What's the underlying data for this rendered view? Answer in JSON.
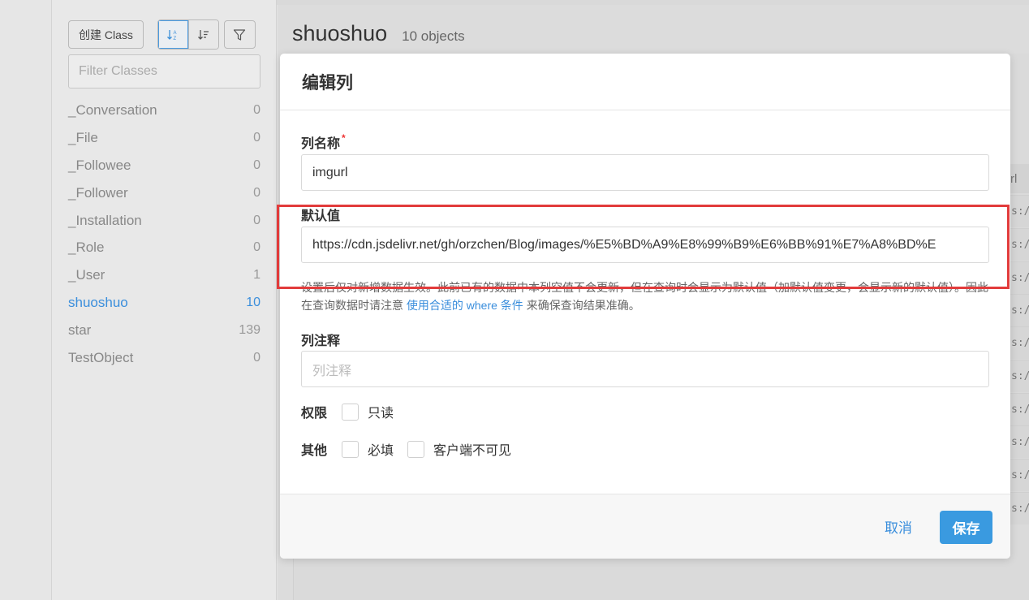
{
  "sidebar": {
    "create_label": "创建 Class",
    "sort_alpha_icon": "sort-alpha-icon",
    "sort_count_icon": "sort-count-icon",
    "filter_icon": "filter-icon",
    "filter_placeholder": "Filter Classes",
    "classes": [
      {
        "name": "_Conversation",
        "count": "0"
      },
      {
        "name": "_File",
        "count": "0"
      },
      {
        "name": "_Followee",
        "count": "0"
      },
      {
        "name": "_Follower",
        "count": "0"
      },
      {
        "name": "_Installation",
        "count": "0"
      },
      {
        "name": "_Role",
        "count": "0"
      },
      {
        "name": "_User",
        "count": "1"
      },
      {
        "name": "shuoshuo",
        "count": "10",
        "active": true
      },
      {
        "name": "star",
        "count": "139"
      },
      {
        "name": "TestObject",
        "count": "0"
      }
    ]
  },
  "main": {
    "class_name": "shuoshuo",
    "object_count": "10 objects",
    "column_header_fragment": "rl",
    "row_fragment": "s:/"
  },
  "modal": {
    "title": "编辑列",
    "column_name_label": "列名称",
    "required_mark": "*",
    "column_name_value": "imgurl",
    "default_label": "默认值",
    "default_value": "https://cdn.jsdelivr.net/gh/orzchen/Blog/images/%E5%BD%A9%E8%99%B9%E6%BB%91%E7%A8%BD%E",
    "help_text_before": "设置后仅对新增数据生效。此前已有的数据中本列空值不会更新，但在查询时会显示为默认值（加默认值变更，会显示新的默认值）。因此在查询数据时请注意 ",
    "help_link": "使用合适的 where 条件",
    "help_text_after": " 来确保查询结果准确。",
    "comment_label": "列注释",
    "comment_placeholder": "列注释",
    "permission_label": "权限",
    "readonly_label": "只读",
    "other_label": "其他",
    "required_label": "必填",
    "client_hidden_label": "客户端不可见",
    "cancel_label": "取消",
    "save_label": "保存"
  },
  "colors": {
    "accent": "#3a8edc",
    "save_button": "#3a9ae0",
    "highlight": "#e23b3b"
  }
}
